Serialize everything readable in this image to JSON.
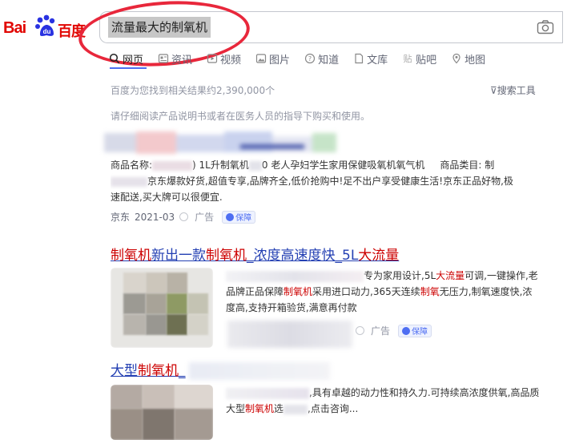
{
  "logo": {
    "text_latin": "Bai",
    "text_cn": "百度"
  },
  "search": {
    "query": "流量最大的制氧机"
  },
  "tabs": [
    {
      "label": "网页",
      "icon": "search-icon",
      "active": true
    },
    {
      "label": "资讯",
      "icon": "news-icon"
    },
    {
      "label": "视频",
      "icon": "video-icon"
    },
    {
      "label": "图片",
      "icon": "image-icon"
    },
    {
      "label": "知道",
      "icon": "question-icon"
    },
    {
      "label": "文库",
      "icon": "document-icon"
    },
    {
      "label": "贴吧",
      "icon": "tieba-icon"
    },
    {
      "label": "地图",
      "icon": "map-icon"
    }
  ],
  "results_info": {
    "count_text": "百度为您找到相关结果约2,390,000个",
    "tools_label": "搜索工具"
  },
  "notice": "请仔细阅读产品说明书或者在医务人员的指导下购买和使用。",
  "ad1": {
    "desc_line1_a": "商品名称:",
    "desc_line1_b": ") 1L升制氧机",
    "desc_line1_c": "0 老人孕妇学生家用保健吸氧机氧气机",
    "desc_line1_d": "商品类目: 制",
    "desc_line2": "京东爆款好货,超值专享,品牌齐全,低价抢购中!足不出户享受健康生活!京东正品好物,极",
    "desc_line3": "速配送,买大牌可以很便宜.",
    "source": "京东",
    "date": "2021-03",
    "ad_label": "广告",
    "guarantee": "保障"
  },
  "result2": {
    "title_hl1": "制氧机",
    "title_mid": "新出一款",
    "title_hl2": "制氧机",
    "title_rest": "_浓度高速度快_5L",
    "title_hl3": "大流量",
    "desc_l1_a": "专为家用设计,5L",
    "desc_l1_hl": "大流量",
    "desc_l1_b": "可调,一键操作,老",
    "desc_l2_a": "品牌正品保障",
    "desc_l2_hl": "制氧机",
    "desc_l2_b": "采用进口动力,365天连续",
    "desc_l2_hl2": "制氧",
    "desc_l2_c": "无压力,制氧速度快,浓",
    "desc_l3": "度高,支持开箱验货,满意再付款",
    "ad_label": "广告",
    "guarantee": "保障"
  },
  "result3": {
    "title_a": "大型",
    "title_hl": "制氧机",
    "title_b": "_",
    "desc_l1": ",具有卓越的动力性和持久力.可持续高浓度供氧,高品质",
    "desc_l2_a": "大型",
    "desc_l2_hl": "制氧机",
    "desc_l2_b": "选",
    "desc_l2_c": ",点击咨询..."
  },
  "colors": {
    "brand_red": "#e10602",
    "link_blue": "#2440b3",
    "highlight_red": "#cc0000",
    "annotation_red": "#e8273b"
  }
}
